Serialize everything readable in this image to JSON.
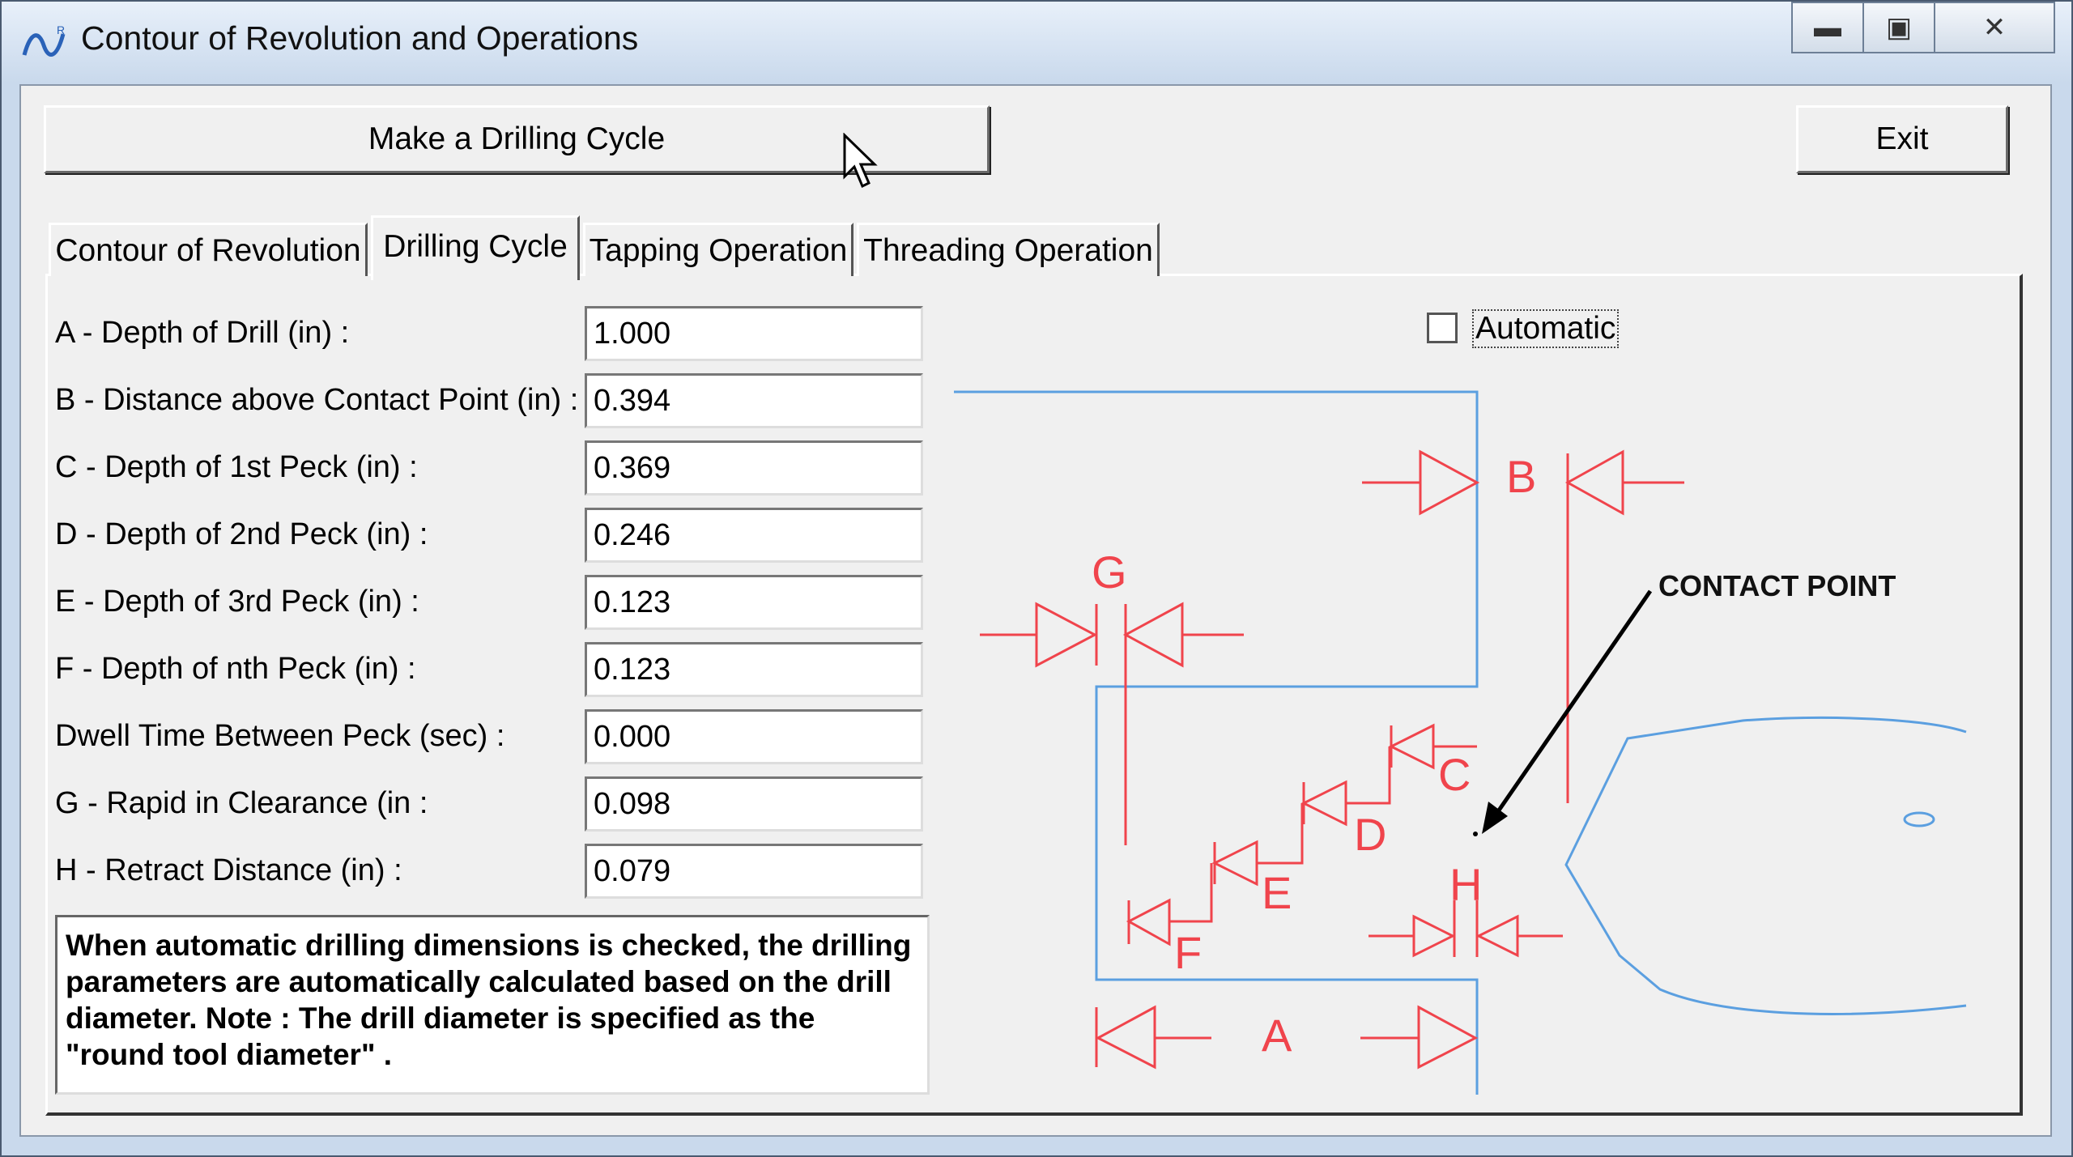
{
  "window": {
    "title": "Contour of Revolution and Operations"
  },
  "title_controls": {
    "minimize": "▬",
    "maximize": "▣",
    "close": "✕"
  },
  "toolbar": {
    "make_button": "Make a Drilling Cycle",
    "exit_button": "Exit"
  },
  "tabs": [
    {
      "label": "Contour of Revolution"
    },
    {
      "label": "Drilling Cycle",
      "active": true
    },
    {
      "label": "Tapping Operation"
    },
    {
      "label": "Threading Operation"
    }
  ],
  "fields": [
    {
      "label": "A - Depth of Drill  (in) :",
      "value": "1.000"
    },
    {
      "label": "B - Distance above Contact Point (in) :",
      "value": "0.394"
    },
    {
      "label": "C - Depth of 1st Peck (in) :",
      "value": "0.369"
    },
    {
      "label": "D - Depth of 2nd Peck (in) :",
      "value": "0.246"
    },
    {
      "label": "E - Depth of 3rd Peck (in) :",
      "value": "0.123"
    },
    {
      "label": "F - Depth of nth Peck (in) :",
      "value": "0.123"
    },
    {
      "label": "Dwell Time Between Peck (sec) :",
      "value": "0.000"
    },
    {
      "label": "G - Rapid in Clearance (in :",
      "value": "0.098"
    },
    {
      "label": "H - Retract Distance (in) :",
      "value": "0.079"
    }
  ],
  "automatic": {
    "label": "Automatic",
    "checked": false
  },
  "note": "When automatic drilling dimensions is checked, the drilling parameters  are automatically calculated based on the drill diameter.  Note : The drill diameter is specified as the \"round tool diameter\" .",
  "diagram": {
    "letters": {
      "A": "A",
      "B": "B",
      "C": "C",
      "D": "D",
      "E": "E",
      "F": "F",
      "G": "G",
      "H": "H"
    },
    "contact_label": "CONTACT POINT",
    "colors": {
      "dimension": "#f0444c",
      "outline": "#5b9fe0",
      "arrow": "#000000"
    }
  },
  "colors": {
    "frame": "#c9d9ec",
    "client": "#f0f0f0"
  }
}
